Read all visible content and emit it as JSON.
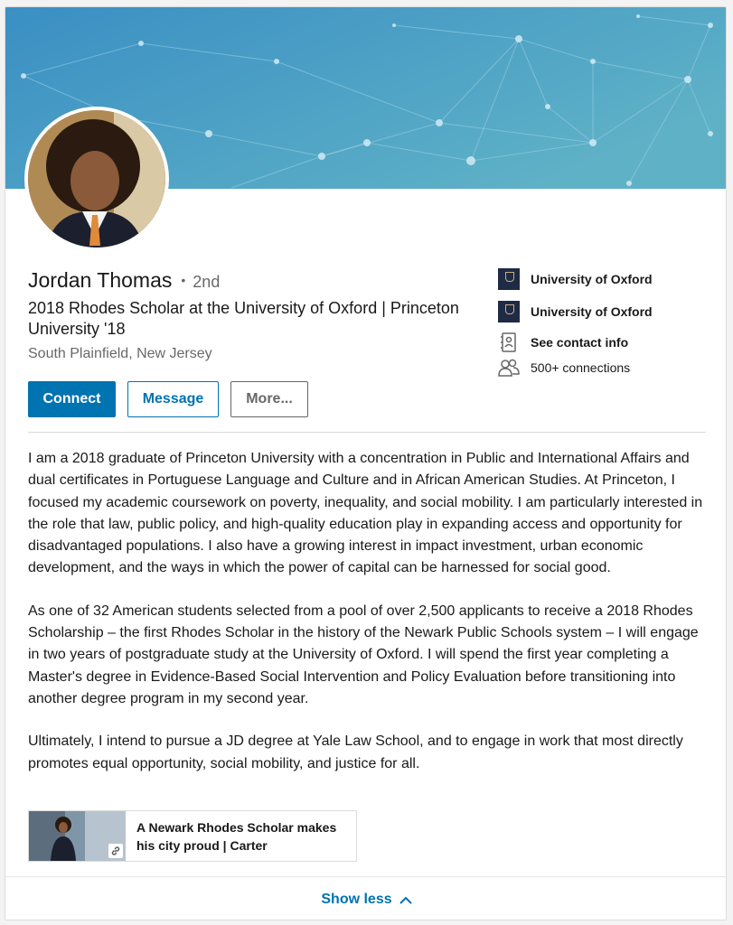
{
  "profile": {
    "name": "Jordan Thomas",
    "degree_separator": "•",
    "degree": "2nd",
    "headline": "2018 Rhodes Scholar at the University of Oxford | Princeton University '18",
    "location": "South Plainfield, New Jersey"
  },
  "actions": {
    "connect": "Connect",
    "message": "Message",
    "more": "More..."
  },
  "sidebar": {
    "items": [
      {
        "icon": "university-logo-icon",
        "label": "University of Oxford"
      },
      {
        "icon": "university-logo-icon",
        "label": "University of Oxford"
      },
      {
        "icon": "contact-card-icon",
        "label": "See contact info"
      },
      {
        "icon": "people-icon",
        "label": "500+ connections"
      }
    ]
  },
  "summary": {
    "paragraphs": [
      "I am a 2018 graduate of Princeton University with a concentration in Public and International Affairs and dual certificates in Portuguese Language and Culture and in African American Studies. At Princeton, I focused my academic coursework on poverty, inequality, and social mobility. I am particularly interested in the role that law, public policy, and high-quality education play in expanding access and opportunity for disadvantaged populations. I also have a growing interest in impact investment, urban economic development, and the ways in which the power of capital can be harnessed for social good.",
      "As one of 32 American students selected from a pool of over 2,500 applicants to receive a 2018 Rhodes Scholarship – the first Rhodes Scholar in the history of the Newark Public Schools system – I will engage in two years of postgraduate study at the University of Oxford. I will spend the first year completing a Master's degree in Evidence-Based Social Intervention and Policy Evaluation before transitioning into another degree program in my second year.",
      "Ultimately, I intend to pursue a JD degree at Yale Law School, and to engage in work that most directly promotes equal opportunity, social mobility, and justice for all."
    ]
  },
  "media": {
    "title": "A Newark Rhodes Scholar makes his city proud | Carter",
    "icon": "link-icon"
  },
  "footer": {
    "show_less": "Show less",
    "icon": "chevron-up-icon"
  },
  "colors": {
    "brand_blue": "#0073b1",
    "banner_start": "#3a8fc4",
    "banner_end": "#5fb2c6"
  }
}
